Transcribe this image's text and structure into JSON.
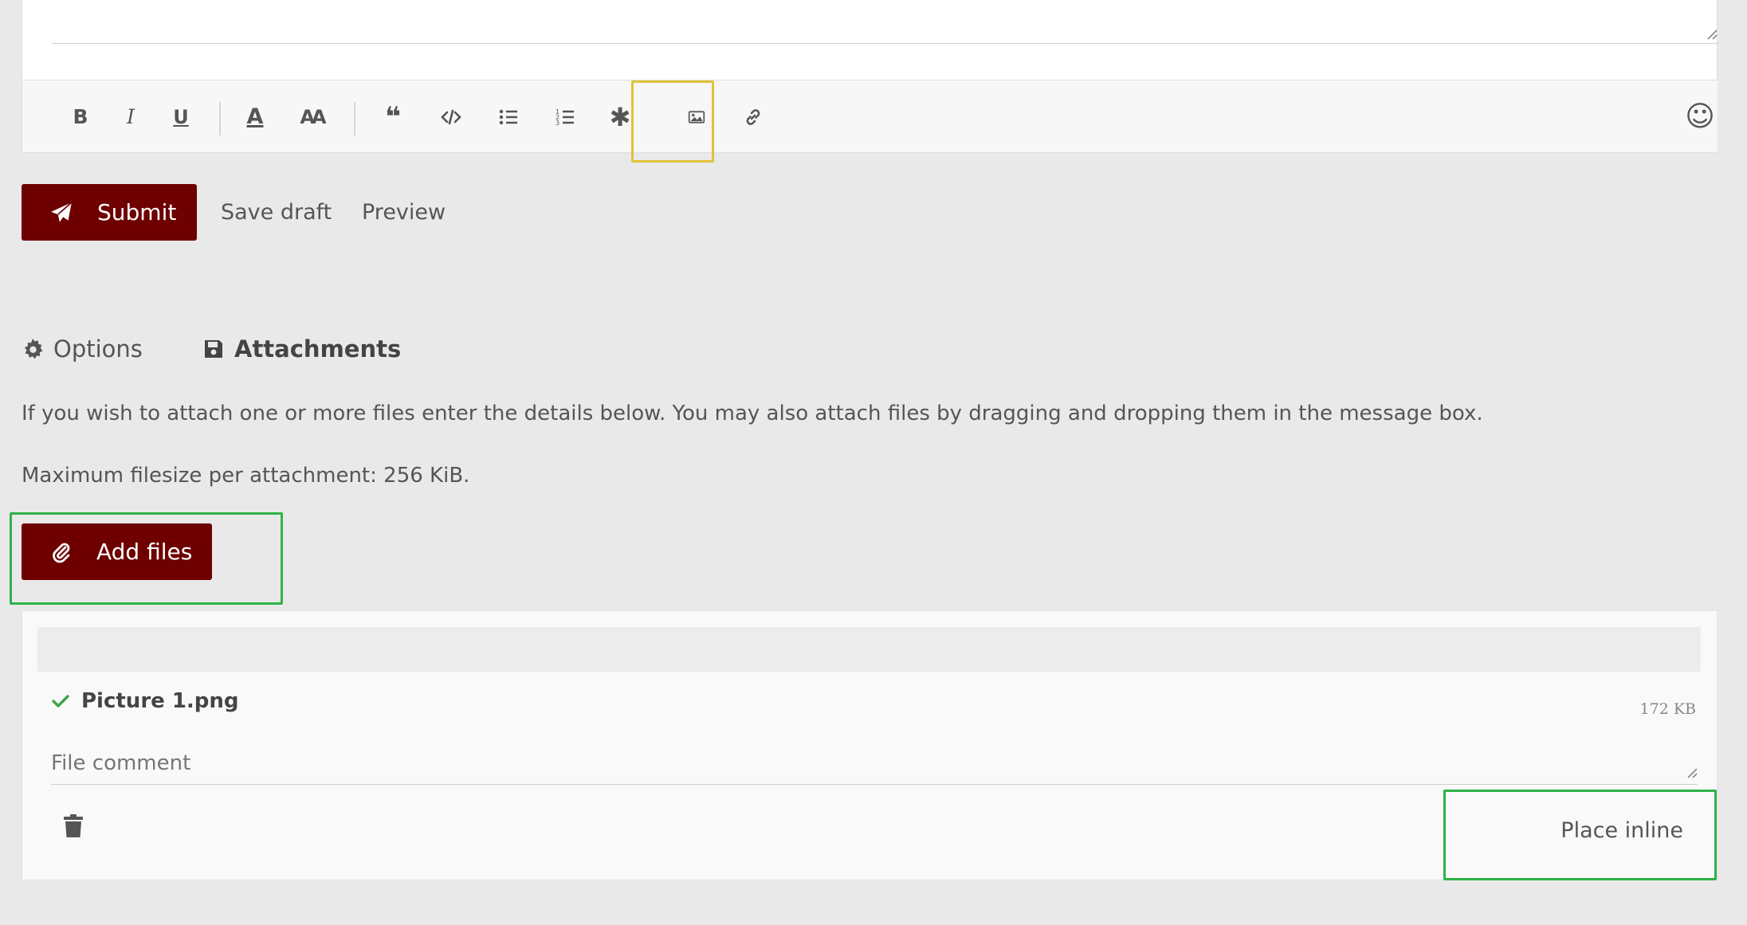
{
  "toolbar": {
    "buttons": [
      "bold-icon",
      "italic-icon",
      "underline-icon",
      "font-color-icon",
      "font-size-icon",
      "quote-icon",
      "code-icon",
      "bullet-list-icon",
      "numbered-list-icon",
      "asterisk-icon",
      "image-icon",
      "link-icon"
    ],
    "bold_glyph": "B",
    "italic_glyph": "I",
    "underline_glyph": "U",
    "fontcolor_glyph": "A",
    "fontsize_glyph": "AA",
    "quote_glyph": "❝",
    "asterisk_glyph": "✱",
    "emoji_glyph": "☺"
  },
  "actions": {
    "submit_label": "Submit",
    "save_draft_label": "Save draft",
    "preview_label": "Preview"
  },
  "tabs": {
    "options_label": "Options",
    "attachments_label": "Attachments"
  },
  "attachments": {
    "description": "If you wish to attach one or more files enter the details below. You may also attach files by dragging and dropping them in the message box.",
    "max_size": "Maximum filesize per attachment: 256 KiB.",
    "add_files_label": "Add files",
    "file": {
      "name": "Picture 1.png",
      "size": "172 KB",
      "comment_placeholder": "File comment",
      "place_inline_label": "Place inline"
    }
  },
  "colors": {
    "primary_button": "#6e0000",
    "highlight_yellow": "#e0c33a",
    "highlight_green": "#2fb24a",
    "check_green": "#3aa54b"
  }
}
